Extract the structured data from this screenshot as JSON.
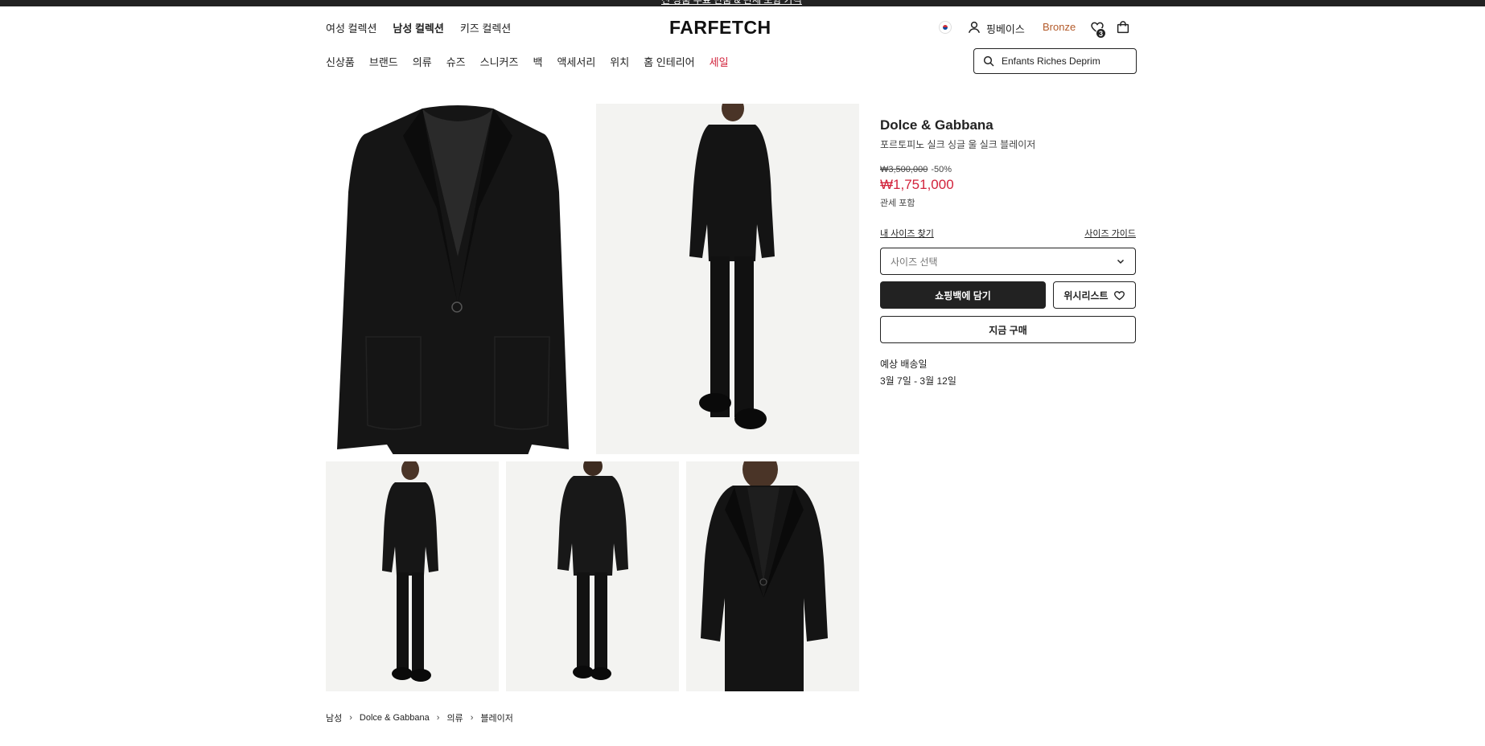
{
  "promo_bar": {
    "text": "전 상품 무료 반품 & 관세 포함 가격"
  },
  "header": {
    "gender_nav": [
      {
        "label": "여성 컬렉션",
        "active": false
      },
      {
        "label": "남성 컬렉션",
        "active": true
      },
      {
        "label": "키즈 컬렉션",
        "active": false
      }
    ],
    "logo": "FARFETCH",
    "user_name": "핑베이스",
    "tier": "Bronze",
    "wishlist_count": "3",
    "categories": [
      "신상품",
      "브랜드",
      "의류",
      "슈즈",
      "스니커즈",
      "백",
      "액세서리",
      "위치",
      "홈 인테리어"
    ],
    "sale_label": "세일",
    "search_value": "Enfants Riches Deprim"
  },
  "product": {
    "brand": "Dolce & Gabbana",
    "name": "포르토피노 실크 싱글 울 실크 블레이저",
    "old_price": "₩3,500,000",
    "discount": "-50%",
    "price": "₩1,751,000",
    "duty_note": "관세 포함",
    "find_size": "내 사이즈 찾기",
    "size_guide": "사이즈 가이드",
    "size_placeholder": "사이즈 선택",
    "add_to_bag": "쇼핑백에 담기",
    "wishlist": "위시리스트",
    "buy_now": "지금 구매",
    "shipping_label": "예상 배송일",
    "shipping_date": "3월 7일 - 3월 12일"
  },
  "breadcrumb": [
    "남성",
    "Dolce & Gabbana",
    "의류",
    "블레이저"
  ],
  "colors": {
    "sale": "#d2233c",
    "tier": "#b35a2a",
    "primary": "#222222"
  }
}
